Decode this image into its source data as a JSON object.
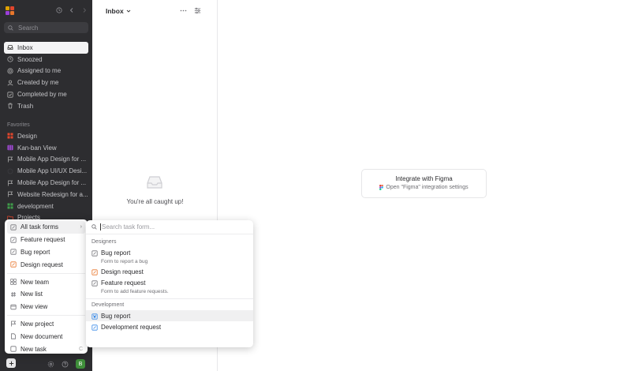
{
  "sidebar": {
    "search_placeholder": "Search",
    "nav": [
      {
        "label": "Inbox",
        "icon": "inbox-icon"
      },
      {
        "label": "Snoozed",
        "icon": "clock-icon"
      },
      {
        "label": "Assigned to me",
        "icon": "target-icon"
      },
      {
        "label": "Created by me",
        "icon": "user-icon"
      },
      {
        "label": "Completed by me",
        "icon": "check-square-icon"
      },
      {
        "label": "Trash",
        "icon": "trash-icon"
      }
    ],
    "favorites_label": "Favorites",
    "favorites": [
      {
        "label": "Design",
        "icon": "grid-icon"
      },
      {
        "label": "Kan-ban View",
        "icon": "board-icon"
      },
      {
        "label": "Mobile App Design for ...",
        "icon": "flag-icon"
      },
      {
        "label": "Mobile App UI/UX Desi...",
        "icon": "circle-icon"
      },
      {
        "label": "Mobile App Design for ...",
        "icon": "flag-icon"
      },
      {
        "label": "Website Redesign for a...",
        "icon": "flag-icon"
      },
      {
        "label": "development",
        "icon": "grid-icon"
      },
      {
        "label": "Projects",
        "icon": "folder-icon"
      }
    ],
    "avatar_initial": "B"
  },
  "inbox": {
    "title": "Inbox",
    "empty_text": "You're all caught up!"
  },
  "main": {
    "integrate_title": "Integrate with Figma",
    "integrate_link": "Open \"Figma\" integration settings"
  },
  "menu": {
    "items_top": [
      {
        "label": "All task forms",
        "icon": "form-icon"
      },
      {
        "label": "Feature request",
        "icon": "form-icon"
      },
      {
        "label": "Bug report",
        "icon": "form-icon"
      },
      {
        "label": "Design request",
        "icon": "form-icon"
      }
    ],
    "items_mid": [
      {
        "label": "New team",
        "icon": "team-icon"
      },
      {
        "label": "New list",
        "icon": "hash-icon"
      },
      {
        "label": "New view",
        "icon": "view-icon"
      }
    ],
    "items_bottom": [
      {
        "label": "New project",
        "icon": "flag-icon"
      },
      {
        "label": "New document",
        "icon": "document-icon"
      },
      {
        "label": "New task",
        "icon": "task-icon"
      }
    ],
    "new_task_shortcut": "C"
  },
  "submenu": {
    "search_placeholder": "Search task form...",
    "groups": [
      {
        "name": "Designers",
        "items": [
          {
            "label": "Bug report",
            "desc": "Form to report a bug"
          },
          {
            "label": "Design request",
            "desc": ""
          },
          {
            "label": "Feature request",
            "desc": "Form to add feature requests."
          }
        ]
      },
      {
        "name": "Development",
        "items": [
          {
            "label": "Bug report",
            "desc": ""
          },
          {
            "label": "Development request",
            "desc": ""
          }
        ]
      }
    ]
  },
  "colors": {
    "sidebar_bg": "#2d2d30",
    "accent_blue": "#3b8be8",
    "accent_orange": "#e8762c",
    "accent_purple": "#a24ad8",
    "accent_red": "#d9534f",
    "accent_green": "#3f8f3a"
  }
}
